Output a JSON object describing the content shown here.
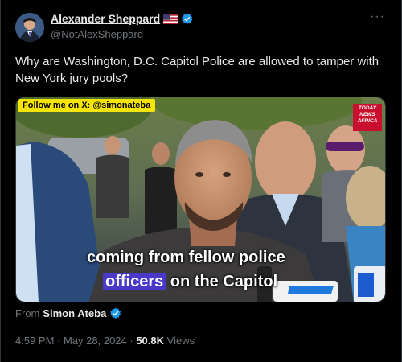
{
  "author": {
    "display_name": "Alexander Sheppard",
    "handle": "@NotAlexSheppard",
    "more_label": "···"
  },
  "tweet": {
    "text": "Why are Washington, D.C. Capitol Police are allowed to tamper with New York jury pools?"
  },
  "media": {
    "follow_tag": "Follow me on X: @simonateba",
    "news_logo": {
      "line1": "TODAY",
      "line2": "NEWS",
      "line3": "AFRICA"
    },
    "caption_line1": "coming from fellow police",
    "caption_highlight": "officers",
    "caption_rest": " on the Capitol"
  },
  "attribution": {
    "prefix": "From",
    "name": "Simon Ateba"
  },
  "meta": {
    "time": "4:59 PM",
    "sep1": " · ",
    "date": "May 28, 2024",
    "sep2": " · ",
    "views": "50.8K",
    "views_label": " Views"
  },
  "colors": {
    "verified": "#1d9bf0",
    "follow_tag": "#f6e500",
    "caption_highlight": "#4a39c9",
    "news_logo": "#c8102e"
  }
}
